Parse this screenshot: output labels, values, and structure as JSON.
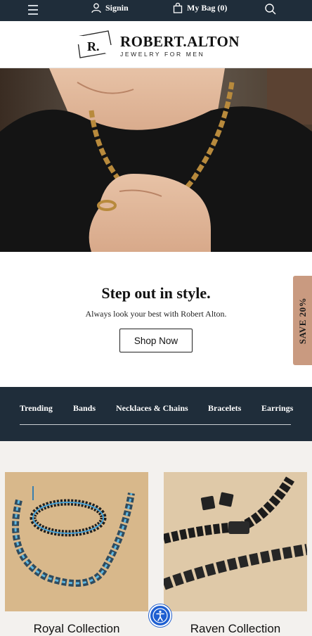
{
  "header": {
    "signin_label": "Signin",
    "bag_label": "My Bag (0)"
  },
  "brand": {
    "mark": "R.",
    "name": "ROBERT.ALTON",
    "tagline": "JEWELRY FOR MEN"
  },
  "promo": {
    "heading": "Step out in style.",
    "subtext": "Always look your best with Robert Alton.",
    "button_label": "Shop Now",
    "side_tab": "SAVE 20%"
  },
  "categories": [
    "Trending",
    "Bands",
    "Necklaces & Chains",
    "Bracelets",
    "Earrings"
  ],
  "products": [
    {
      "title": "Royal Collection"
    },
    {
      "title": "Raven Collection"
    }
  ],
  "colors": {
    "navy": "#1f2d3a",
    "save_tab": "#c99a80",
    "accessibility_blue": "#1f5fd1"
  },
  "icons": {
    "menu": "menu-icon",
    "user": "user-icon",
    "bag": "shopping-bag-icon",
    "search": "search-icon",
    "accessibility": "accessibility-icon"
  }
}
